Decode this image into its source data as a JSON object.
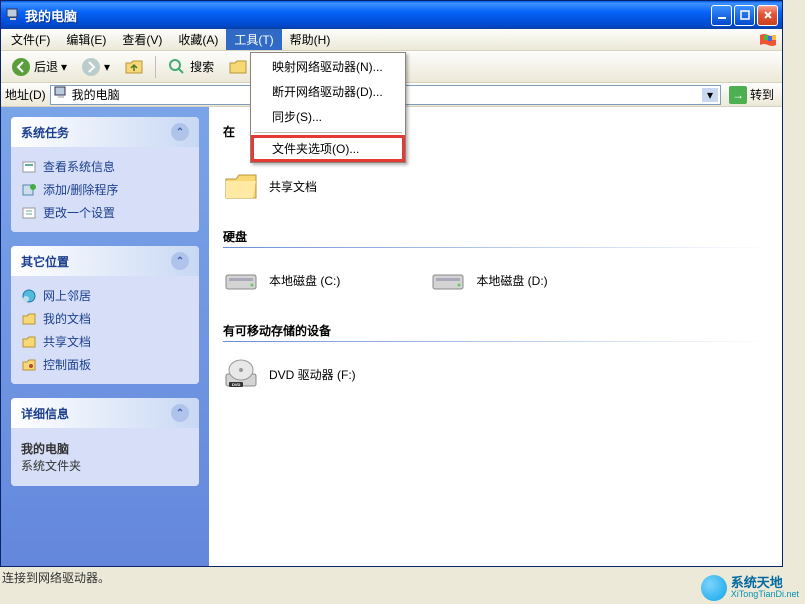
{
  "titlebar": {
    "title": "我的电脑"
  },
  "menubar": {
    "items": [
      {
        "label": "文件(F)"
      },
      {
        "label": "编辑(E)"
      },
      {
        "label": "查看(V)"
      },
      {
        "label": "收藏(A)"
      },
      {
        "label": "工具(T)",
        "active": true
      },
      {
        "label": "帮助(H)"
      }
    ]
  },
  "toolbar": {
    "back": "后退",
    "search": "搜索",
    "folders_partial": "文"
  },
  "addressbar": {
    "label": "地址(D)",
    "value": "我的电脑",
    "go": "转到"
  },
  "dropdown": {
    "items": [
      {
        "label": "映射网络驱动器(N)..."
      },
      {
        "label": "断开网络驱动器(D)..."
      },
      {
        "label": "同步(S)..."
      }
    ],
    "highlighted": {
      "label": "文件夹选项(O)..."
    }
  },
  "sidebar": {
    "panels": [
      {
        "title": "系统任务",
        "links": [
          {
            "icon": "info-icon",
            "label": "查看系统信息"
          },
          {
            "icon": "programs-icon",
            "label": "添加/删除程序"
          },
          {
            "icon": "settings-icon",
            "label": "更改一个设置"
          }
        ]
      },
      {
        "title": "其它位置",
        "links": [
          {
            "icon": "network-icon",
            "label": "网上邻居"
          },
          {
            "icon": "documents-icon",
            "label": "我的文档"
          },
          {
            "icon": "folder-icon",
            "label": "共享文档"
          },
          {
            "icon": "control-icon",
            "label": "控制面板"
          }
        ]
      },
      {
        "title": "详细信息",
        "info_title": "我的电脑",
        "info_sub": "系统文件夹"
      }
    ]
  },
  "content": {
    "section_stored_partial": "在",
    "shared_docs": "共享文档",
    "section_disks": "硬盘",
    "disks": [
      {
        "label": "本地磁盘 (C:)"
      },
      {
        "label": "本地磁盘 (D:)"
      }
    ],
    "section_removable": "有可移动存储的设备",
    "removable": [
      {
        "label": "DVD 驱动器 (F:)"
      }
    ]
  },
  "status": "连接到网络驱动器。",
  "watermark": {
    "name": "系统天地",
    "url": "XiTongTianDi.net"
  }
}
